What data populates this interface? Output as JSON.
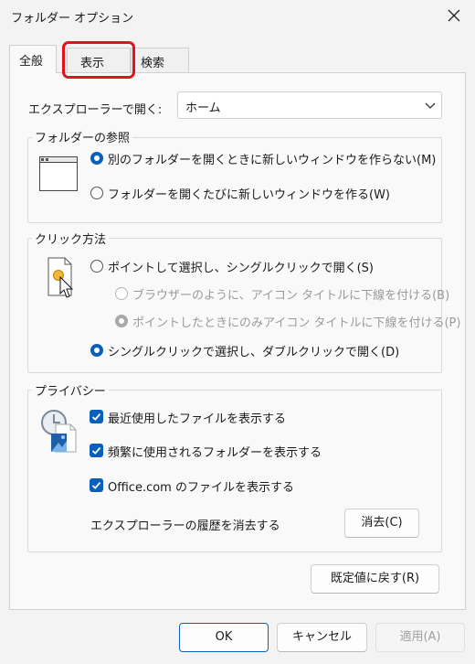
{
  "window": {
    "title": "フォルダー オプション"
  },
  "tabs": [
    {
      "label": "全般"
    },
    {
      "label": "表示"
    },
    {
      "label": "検索"
    }
  ],
  "explorer_open": {
    "label": "エクスプローラーで開く:",
    "value": "ホーム"
  },
  "browse_folders": {
    "legend": "フォルダーの参照",
    "option_same_window": "別のフォルダーを開くときに新しいウィンドウを作らない(M)",
    "option_new_window": "フォルダーを開くたびに新しいウィンドウを作る(W)"
  },
  "click_items": {
    "legend": "クリック方法",
    "single_click": "ポイントして選択し、シングルクリックで開く(S)",
    "underline_browser": "ブラウザーのように、アイコン タイトルに下線を付ける(B)",
    "underline_hover": "ポイントしたときにのみアイコン タイトルに下線を付ける(P)",
    "double_click": "シングルクリックで選択し、ダブルクリックで開く(D)"
  },
  "privacy": {
    "legend": "プライバシー",
    "recent_files": "最近使用したファイルを表示する",
    "frequent_folders": "頻繁に使用されるフォルダーを表示する",
    "office_files": "Office.com のファイルを表示する",
    "clear_history_label": "エクスプローラーの履歴を消去する",
    "clear_button": "消去(C)"
  },
  "restore_defaults": "既定値に戻す(R)",
  "footer": {
    "ok": "OK",
    "cancel": "キャンセル",
    "apply": "適用(A)"
  },
  "colors": {
    "accent": "#0a5fb8",
    "highlight": "#e8101b"
  }
}
